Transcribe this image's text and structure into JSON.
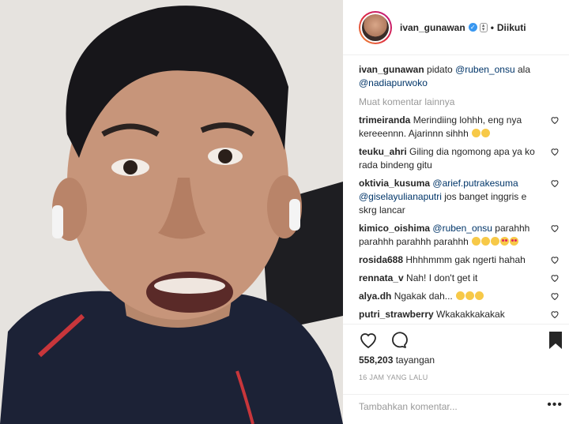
{
  "header": {
    "username": "ivan_gunawan",
    "follow_status": "Diikuti",
    "separator": "•"
  },
  "caption": {
    "user": "ivan_gunawan",
    "text_1": " pidato ",
    "mention_1": "@ruben_onsu",
    "text_2": " ala ",
    "mention_2": "@nadiapurwoko"
  },
  "load_more": "Muat komentar lainnya",
  "comments": [
    {
      "user": "trimeiranda",
      "text": " Merindiing lohhh, eng nya kereeennn. Ajarinnn sihhh ",
      "mention": "",
      "text_after": "",
      "emojis": 2
    },
    {
      "user": "teuku_ahri",
      "text": " Giling dia ngomong apa ya ko rada bindeng gitu",
      "mention": "",
      "text_after": "",
      "emojis": 0
    },
    {
      "user": "oktivia_kusuma",
      "text": " ",
      "mention": "@arief.putrakesuma",
      "mention_2": "@giselayulianaputri",
      "text_after": " jos banget inggris e skrg lancar",
      "emojis": 0
    },
    {
      "user": "kimico_oishima",
      "text": " ",
      "mention": "@ruben_onsu",
      "text_after": " parahhh parahhh parahhh parahhh ",
      "emojis": 5
    },
    {
      "user": "rosida688",
      "text": " Hhhhmmm gak ngerti hahah",
      "mention": "",
      "text_after": "",
      "emojis": 0
    },
    {
      "user": "rennata_v",
      "text": " Nah! I don't get it",
      "mention": "",
      "text_after": "",
      "emojis": 0
    },
    {
      "user": "alya.dh",
      "text": " Ngakak dah... ",
      "mention": "",
      "text_after": "",
      "emojis": 3
    },
    {
      "user": "putri_strawberry",
      "text": " Wkakakkakakak",
      "mention": "",
      "text_after": "",
      "emojis": 0
    }
  ],
  "views": {
    "count": "558,203",
    "label": " tayangan"
  },
  "timestamp": "16 JAM YANG LALU",
  "add_comment": {
    "placeholder": "Tambahkan komentar..."
  },
  "more_options": "•••",
  "colors": {
    "accent": "#3897f0",
    "mention": "#003569",
    "muted": "#999999"
  }
}
